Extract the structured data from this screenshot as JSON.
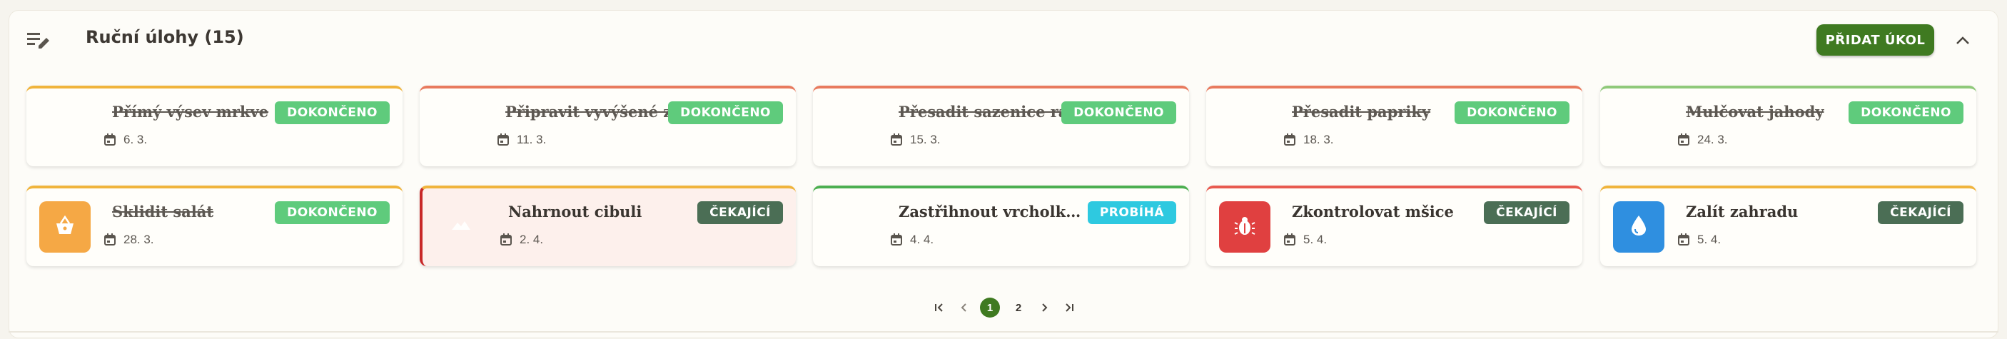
{
  "header": {
    "title": "Ruční úlohy (15)",
    "add_button_label": "PŘIDAT ÚKOL",
    "icon": "edit-list-icon",
    "collapse_icon": "chevron-up-icon"
  },
  "status_colors": {
    "DOKONČENO": "#5fcb7c",
    "ČEKAJÍCÍ": "#4b6e55",
    "PROBÍHÁ": "#2ec9e0"
  },
  "tasks": [
    {
      "title": "Přímý výsev mrkve",
      "date": "6. 3.",
      "status": "DOKONČENO",
      "accent": "#f0b43c",
      "done": true,
      "icon": ""
    },
    {
      "title": "Připravit vyvýšené záhony",
      "date": "11. 3.",
      "status": "DOKONČENO",
      "accent": "#e87a5e",
      "done": true,
      "icon": ""
    },
    {
      "title": "Přesadit sazenice rajčat",
      "date": "15. 3.",
      "status": "DOKONČENO",
      "accent": "#e87a5e",
      "done": true,
      "icon": ""
    },
    {
      "title": "Přesadit papriky",
      "date": "18. 3.",
      "status": "DOKONČENO",
      "accent": "#e87a5e",
      "done": true,
      "icon": ""
    },
    {
      "title": "Mulčovat jahody",
      "date": "24. 3.",
      "status": "DOKONČENO",
      "accent": "#8fc97a",
      "done": true,
      "icon": ""
    },
    {
      "title": "Sklidit salát",
      "date": "28. 3.",
      "status": "DOKONČENO",
      "accent": "#f0b43c",
      "done": true,
      "icon": "basket-icon",
      "icon_bg": "#f5a845"
    },
    {
      "title": "Nahrnout cibuli",
      "date": "2. 4.",
      "status": "ČEKAJÍCÍ",
      "accent": "#f0b43c",
      "done": false,
      "icon": "mound-icon",
      "icon_bg": "",
      "active": true
    },
    {
      "title": "Zastřihnout vrcholky bazalky",
      "date": "4. 4.",
      "status": "PROBÍHÁ",
      "accent": "#4caf50",
      "done": false,
      "icon": ""
    },
    {
      "title": "Zkontrolovat mšice",
      "date": "5. 4.",
      "status": "ČEKAJÍCÍ",
      "accent": "#e85a4f",
      "done": false,
      "icon": "bug-icon",
      "icon_bg": "#e04040"
    },
    {
      "title": "Zalít zahradu",
      "date": "5. 4.",
      "status": "ČEKAJÍCÍ",
      "accent": "#f0b43c",
      "done": false,
      "icon": "water-drop-icon",
      "icon_bg": "#2f8fe0"
    }
  ],
  "pagination": {
    "pages": [
      "1",
      "2"
    ],
    "current": "1"
  }
}
